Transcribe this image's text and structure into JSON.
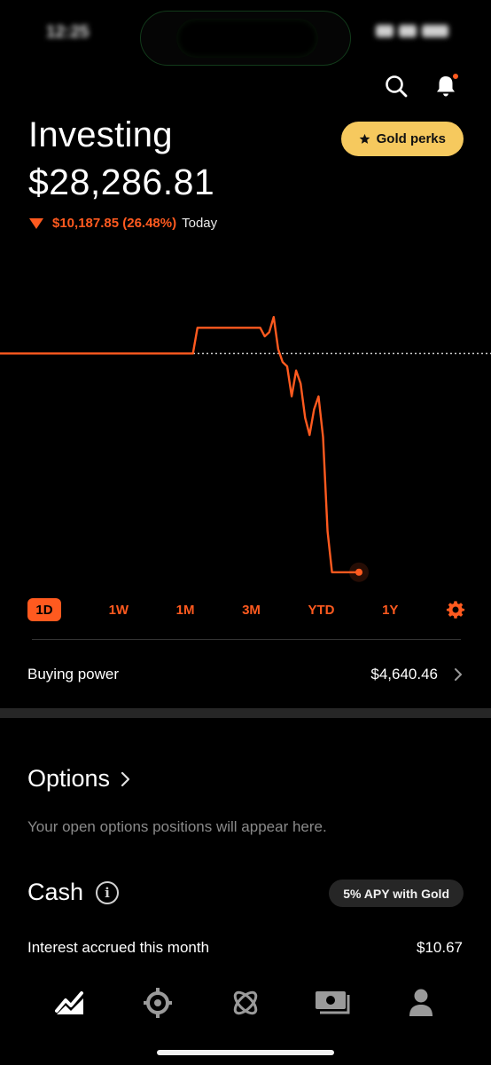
{
  "status_bar": {
    "time": "12:25"
  },
  "header": {
    "title": "Investing",
    "balance": "$28,286.81",
    "change_value": "$10,187.85 (26.48%)",
    "change_label": "Today",
    "gold_button": "Gold perks",
    "icons": [
      "search-icon",
      "bell-icon"
    ]
  },
  "colors": {
    "accent": "#ff5a1f",
    "gold": "#f6c95e",
    "background": "#000000"
  },
  "chart_data": {
    "type": "line",
    "series": [
      {
        "values": [
          0.5,
          0.5,
          0.5,
          0.5,
          0.5,
          0.5,
          0.5,
          0.5,
          0.5,
          0.5,
          0.5,
          0.5,
          0.5,
          0.5,
          0.5,
          0.5,
          0.5,
          0.5,
          0.5,
          0.5,
          0.5,
          0.5,
          0.5,
          0.5,
          0.5,
          0.5,
          0.5,
          0.5,
          0.5,
          0.5,
          0.5,
          0.5,
          0.5,
          0.5,
          0.5,
          0.5,
          0.5,
          0.5,
          0.5,
          0.5,
          0.5,
          0.5,
          0.5,
          0.5,
          0.62,
          0.62,
          0.62,
          0.62,
          0.62,
          0.62,
          0.62,
          0.62,
          0.62,
          0.62,
          0.62,
          0.62,
          0.62,
          0.62,
          0.62,
          0.58,
          0.6,
          0.67,
          0.52,
          0.46,
          0.44,
          0.3,
          0.42,
          0.36,
          0.2,
          0.12,
          0.24,
          0.3,
          0.11,
          -0.33,
          -0.52,
          -0.52,
          -0.52,
          -0.52,
          -0.52,
          -0.52,
          -0.52
        ]
      }
    ],
    "baseline": 0.5,
    "grid": false
  },
  "ranges": {
    "items": [
      "1D",
      "1W",
      "1M",
      "3M",
      "YTD",
      "1Y"
    ],
    "active": "1D",
    "settings_icon": "gear-icon"
  },
  "buying_power": {
    "label": "Buying power",
    "value": "$4,640.46"
  },
  "options": {
    "title": "Options",
    "description": "Your open options positions will appear here."
  },
  "cash": {
    "title": "Cash",
    "badge": "5% APY with Gold",
    "interest_label": "Interest accrued this month",
    "interest_value": "$10.67"
  },
  "tabbar": {
    "icons": [
      "investing-chart-icon",
      "crypto-icon",
      "options-atom-icon",
      "cash-card-icon",
      "account-person-icon"
    ]
  }
}
